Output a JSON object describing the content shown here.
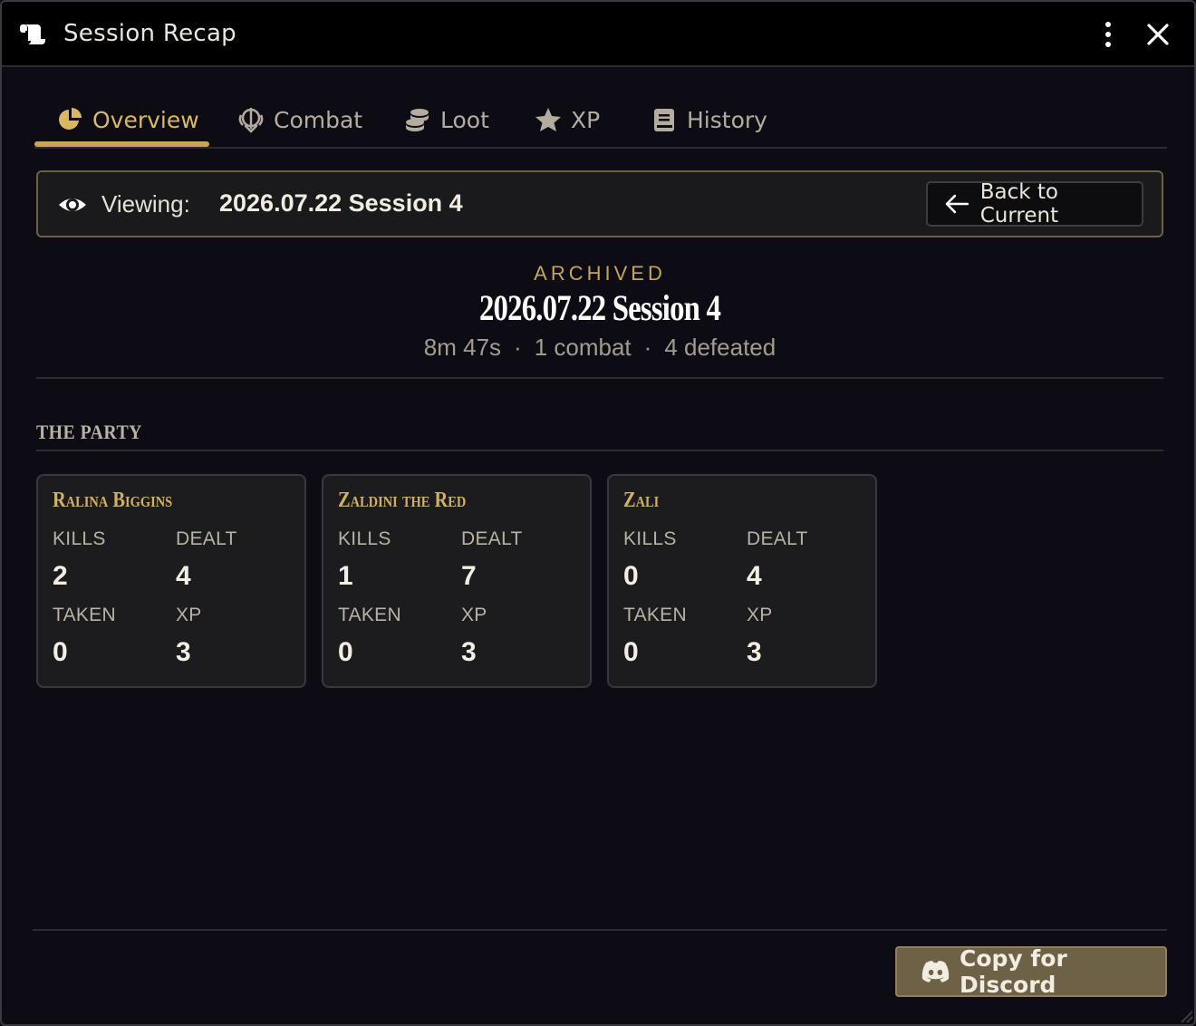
{
  "window": {
    "title": "Session Recap"
  },
  "tabs": [
    {
      "label": "Overview",
      "icon": "pie-chart-icon",
      "active": true
    },
    {
      "label": "Combat",
      "icon": "crossed-swords-icon",
      "active": false
    },
    {
      "label": "Loot",
      "icon": "coins-icon",
      "active": false
    },
    {
      "label": "XP",
      "icon": "star-icon",
      "active": false
    },
    {
      "label": "History",
      "icon": "book-icon",
      "active": false
    }
  ],
  "viewing": {
    "label": "Viewing:",
    "value": "2026.07.22 Session 4",
    "back_button": "Back to Current"
  },
  "session": {
    "status": "ARCHIVED",
    "title": "2026.07.22 Session 4",
    "duration": "8m 47s",
    "combats": "1 combat",
    "defeated": "4 defeated",
    "separator": "·"
  },
  "party": {
    "heading": "THE PARTY",
    "stat_labels": {
      "kills": "KILLS",
      "dealt": "DEALT",
      "taken": "TAKEN",
      "xp": "XP"
    },
    "members": [
      {
        "name": "Ralina Biggins",
        "kills": "2",
        "dealt": "4",
        "taken": "0",
        "xp": "3"
      },
      {
        "name": "Zaldini the Red",
        "kills": "1",
        "dealt": "7",
        "taken": "0",
        "xp": "3"
      },
      {
        "name": "Zali",
        "kills": "0",
        "dealt": "4",
        "taken": "0",
        "xp": "3"
      }
    ]
  },
  "footer": {
    "discord_button": "Copy for Discord"
  },
  "colors": {
    "accent": "#c9a656",
    "background": "#0d0c15",
    "card": "#1c1c1e",
    "button": "#6e6246"
  }
}
